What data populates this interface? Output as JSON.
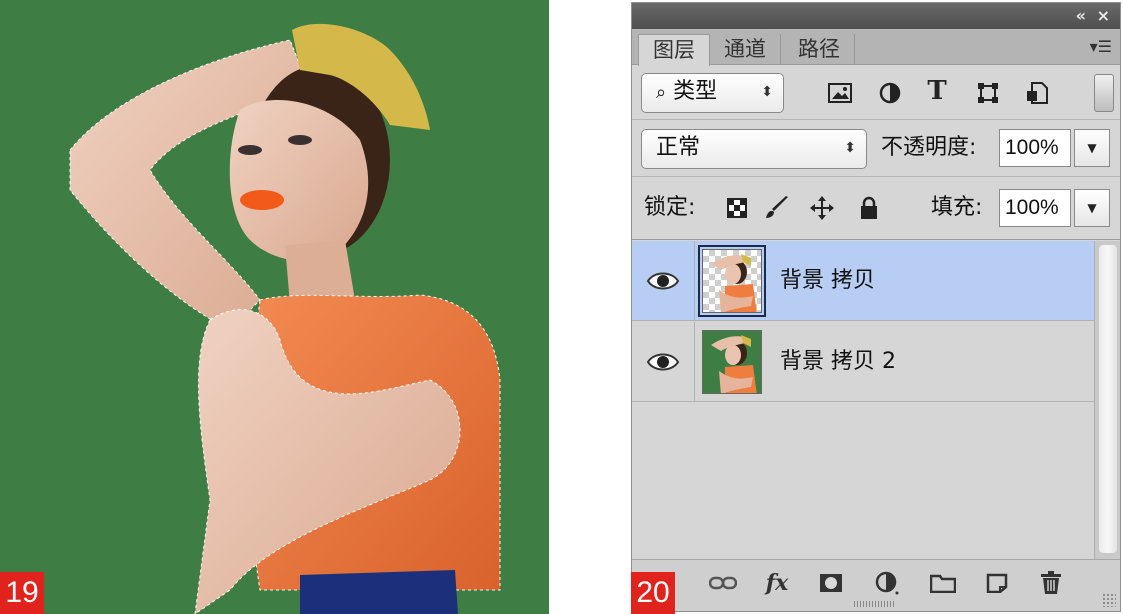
{
  "figures": {
    "left": "19",
    "right": "20"
  },
  "panel": {
    "tabs": [
      {
        "label": "图层",
        "active": true
      },
      {
        "label": "通道",
        "active": false
      },
      {
        "label": "路径",
        "active": false
      }
    ],
    "filter": {
      "icon": "search-icon",
      "value": "类型"
    },
    "filter_icons": [
      "image-filter-icon",
      "adjustment-filter-icon",
      "type-filter-icon",
      "shape-filter-icon",
      "smart-object-filter-icon"
    ],
    "type_icon_glyph": "T",
    "blend_mode": "正常",
    "opacity_label": "不透明度:",
    "opacity_value": "100%",
    "lock_label": "锁定:",
    "fill_label": "填充:",
    "fill_value": "100%",
    "layers": [
      {
        "name": "背景 拷贝",
        "visible": true,
        "selected": true
      },
      {
        "name": "背景 拷贝 2",
        "visible": true,
        "selected": false
      }
    ],
    "bottom_icons": [
      "link-layers-icon",
      "fx-icon",
      "add-mask-icon",
      "adjustment-layer-icon",
      "new-group-icon",
      "new-layer-icon",
      "delete-icon"
    ],
    "fx_glyph": "fx"
  },
  "colors": {
    "background_green": "#3e7d43",
    "selected_layer": "#b8cdf4",
    "figure_badge": "#e0231c"
  }
}
